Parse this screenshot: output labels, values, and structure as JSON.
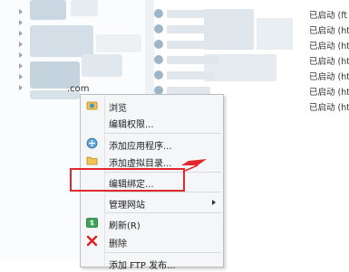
{
  "tree": {
    "site_label": ".com"
  },
  "site_list": {
    "rows": [
      {
        "status": "已启动 (ft"
      },
      {
        "status": "已启动 (ht"
      },
      {
        "status": "已启动 (ht"
      },
      {
        "status": "已启动 (ht"
      },
      {
        "status": "已启动 (ht"
      },
      {
        "status": "已启动 (ht"
      },
      {
        "status": "已启动 (ht"
      }
    ]
  },
  "context_menu": {
    "items": [
      {
        "label": "浏览",
        "icon": "explore-icon"
      },
      {
        "label": "编辑权限...",
        "icon": ""
      },
      {
        "label": "添加应用程序...",
        "icon": "add-application-icon"
      },
      {
        "label": "添加虚拟目录...",
        "icon": "add-virtual-directory-icon"
      },
      {
        "label": "编辑绑定...",
        "icon": ""
      },
      {
        "label": "管理网站",
        "icon": ""
      },
      {
        "label": "刷新(R)",
        "icon": "refresh-icon"
      },
      {
        "label": "删除",
        "icon": "delete-icon"
      },
      {
        "label": "添加 FTP 发布...",
        "icon": ""
      }
    ]
  },
  "annotation": {
    "highlight_color": "#e2282c"
  }
}
